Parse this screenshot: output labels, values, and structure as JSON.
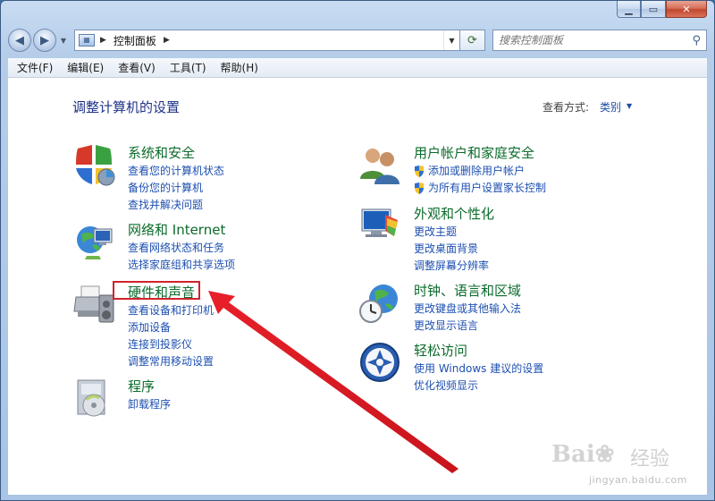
{
  "address": {
    "path": "控制面板",
    "search_placeholder": "搜索控制面板"
  },
  "menu": [
    "文件(F)",
    "编辑(E)",
    "查看(V)",
    "工具(T)",
    "帮助(H)"
  ],
  "main": {
    "title": "调整计算机的设置",
    "view_by_label": "查看方式:",
    "view_by_value": "类别"
  },
  "categories_left": [
    {
      "title": "系统和安全",
      "icon": "shield-icon",
      "links": [
        "查看您的计算机状态",
        "备份您的计算机",
        "查找并解决问题"
      ]
    },
    {
      "title": "网络和 Internet",
      "icon": "network-icon",
      "links": [
        "查看网络状态和任务",
        "选择家庭组和共享选项"
      ]
    },
    {
      "title": "硬件和声音",
      "icon": "printer-icon",
      "links": [
        "查看设备和打印机",
        "添加设备",
        "连接到投影仪",
        "调整常用移动设置"
      ]
    },
    {
      "title": "程序",
      "icon": "programs-icon",
      "links": [
        "卸载程序"
      ]
    }
  ],
  "categories_right": [
    {
      "title": "用户帐户和家庭安全",
      "icon": "users-icon",
      "links": [
        "添加或删除用户帐户",
        "为所有用户设置家长控制"
      ]
    },
    {
      "title": "外观和个性化",
      "icon": "appearance-icon",
      "links": [
        "更改主题",
        "更改桌面背景",
        "调整屏幕分辨率"
      ]
    },
    {
      "title": "时钟、语言和区域",
      "icon": "clock-globe-icon",
      "links": [
        "更改键盘或其他输入法",
        "更改显示语言"
      ]
    },
    {
      "title": "轻松访问",
      "icon": "ease-of-access-icon",
      "links": [
        "使用 Windows 建议的设置",
        "优化视频显示"
      ]
    }
  ],
  "watermark": {
    "text": "jingyan.baidu.com"
  },
  "colors": {
    "category_title": "#0b6b2b",
    "link": "#1d4fb0",
    "highlight": "#d0232b"
  }
}
